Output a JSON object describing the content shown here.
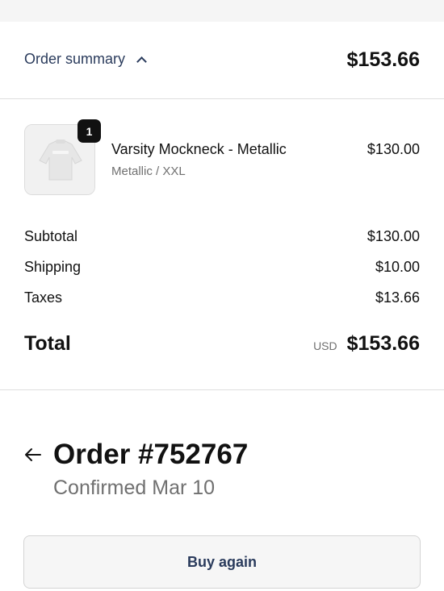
{
  "summary": {
    "toggle_label": "Order summary",
    "toggle_icon": "chevron-up-icon",
    "total": "$153.66"
  },
  "product": {
    "name": "Varsity Mockneck - Metallic",
    "variant": "Metallic / XXL",
    "price": "$130.00",
    "quantity": "1",
    "image_icon": "sweatshirt-thumbnail"
  },
  "costs": {
    "subtotal_label": "Subtotal",
    "subtotal_value": "$130.00",
    "shipping_label": "Shipping",
    "shipping_value": "$10.00",
    "taxes_label": "Taxes",
    "taxes_value": "$13.66",
    "total_label": "Total",
    "currency": "USD",
    "total_value": "$153.66"
  },
  "order": {
    "back_icon": "arrow-left-icon",
    "title": "Order #752767",
    "status": "Confirmed Mar 10"
  },
  "actions": {
    "buy_again_label": "Buy again"
  },
  "colors": {
    "accent": "#2a3b5c",
    "muted": "#707070",
    "badge": "#111111"
  }
}
